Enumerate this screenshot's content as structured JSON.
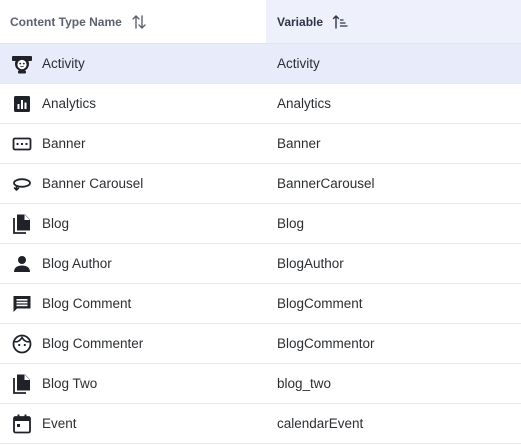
{
  "header": {
    "name_col": "Content Type Name",
    "var_col": "Variable"
  },
  "rows": [
    {
      "name": "Activity",
      "variable": "Activity",
      "icon": "activity-icon",
      "selected": true
    },
    {
      "name": "Analytics",
      "variable": "Analytics",
      "icon": "analytics-icon"
    },
    {
      "name": "Banner",
      "variable": "Banner",
      "icon": "banner-icon"
    },
    {
      "name": "Banner Carousel",
      "variable": "BannerCarousel",
      "icon": "carousel-icon"
    },
    {
      "name": "Blog",
      "variable": "Blog",
      "icon": "document-icon"
    },
    {
      "name": "Blog Author",
      "variable": "BlogAuthor",
      "icon": "person-icon"
    },
    {
      "name": "Blog Comment",
      "variable": "BlogComment",
      "icon": "comment-icon"
    },
    {
      "name": "Blog Commenter",
      "variable": "BlogCommentor",
      "icon": "face-icon"
    },
    {
      "name": "Blog Two",
      "variable": "blog_two",
      "icon": "document-icon"
    },
    {
      "name": "Event",
      "variable": "calendarEvent",
      "icon": "calendar-icon"
    }
  ],
  "colors": {
    "selected_row": "#e8ebf9",
    "sorted_header": "#eef0fb",
    "divider": "#e6e7ea",
    "icon": "#1f2329"
  }
}
